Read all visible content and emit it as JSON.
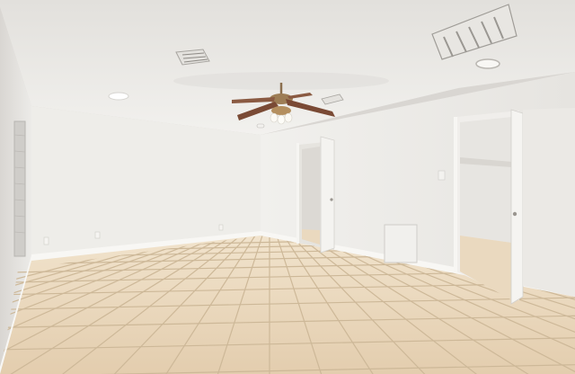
{
  "scene": {
    "subject": "Empty room",
    "colors": {
      "ceiling": "#ecebe8",
      "wall_left": "#e8e6e3",
      "wall_back": "#f0efec",
      "wall_right": "#eceae7",
      "floor_tile": "#e7d4b8",
      "grout": "#c7b295",
      "baseboard": "#f7f6f3",
      "door": "#f4f3f0",
      "fan_blade": "#7a4a35",
      "vent": "#dedcd8"
    }
  }
}
